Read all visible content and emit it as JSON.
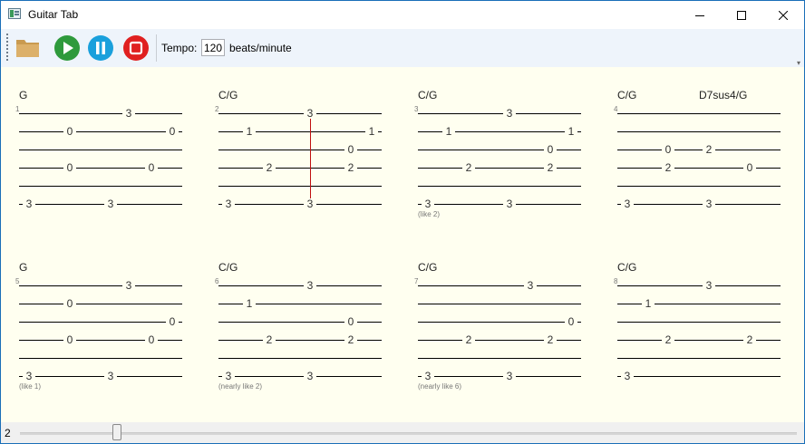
{
  "window": {
    "title": "Guitar Tab"
  },
  "toolbar": {
    "tempo_label": "Tempo:",
    "tempo_value": "120",
    "tempo_unit": "beats/minute",
    "buttons": [
      "open-folder",
      "play",
      "pause",
      "stop"
    ]
  },
  "measures": [
    {
      "number": "1",
      "chords": [
        "G"
      ],
      "note": "",
      "notes": [
        {
          "s": 1,
          "p": 0.67,
          "f": "3"
        },
        {
          "s": 2,
          "p": 0.31,
          "f": "0"
        },
        {
          "s": 2,
          "p": 0.94,
          "f": "0"
        },
        {
          "s": 4,
          "p": 0.31,
          "f": "0"
        },
        {
          "s": 4,
          "p": 0.81,
          "f": "0"
        },
        {
          "s": 6,
          "p": 0.06,
          "f": "3"
        },
        {
          "s": 6,
          "p": 0.56,
          "f": "3"
        }
      ]
    },
    {
      "number": "2",
      "chords": [
        "C/G"
      ],
      "note": "",
      "cursor": 0.56,
      "notes": [
        {
          "s": 1,
          "p": 0.56,
          "f": "3"
        },
        {
          "s": 2,
          "p": 0.19,
          "f": "1"
        },
        {
          "s": 2,
          "p": 0.94,
          "f": "1"
        },
        {
          "s": 3,
          "p": 0.81,
          "f": "0"
        },
        {
          "s": 4,
          "p": 0.31,
          "f": "2"
        },
        {
          "s": 4,
          "p": 0.81,
          "f": "2"
        },
        {
          "s": 6,
          "p": 0.06,
          "f": "3"
        },
        {
          "s": 6,
          "p": 0.56,
          "f": "3"
        }
      ]
    },
    {
      "number": "3",
      "chords": [
        "C/G"
      ],
      "note": "(like 2)",
      "notes": [
        {
          "s": 1,
          "p": 0.56,
          "f": "3"
        },
        {
          "s": 2,
          "p": 0.19,
          "f": "1"
        },
        {
          "s": 2,
          "p": 0.94,
          "f": "1"
        },
        {
          "s": 3,
          "p": 0.81,
          "f": "0"
        },
        {
          "s": 4,
          "p": 0.31,
          "f": "2"
        },
        {
          "s": 4,
          "p": 0.81,
          "f": "2"
        },
        {
          "s": 6,
          "p": 0.06,
          "f": "3"
        },
        {
          "s": 6,
          "p": 0.56,
          "f": "3"
        }
      ]
    },
    {
      "number": "4",
      "chords": [
        "C/G",
        "D7sus4/G"
      ],
      "note": "",
      "notes": [
        {
          "s": 3,
          "p": 0.31,
          "f": "0"
        },
        {
          "s": 3,
          "p": 0.56,
          "f": "2"
        },
        {
          "s": 4,
          "p": 0.31,
          "f": "2"
        },
        {
          "s": 4,
          "p": 0.81,
          "f": "0"
        },
        {
          "s": 6,
          "p": 0.06,
          "f": "3"
        },
        {
          "s": 6,
          "p": 0.56,
          "f": "3"
        }
      ]
    },
    {
      "number": "5",
      "chords": [
        "G"
      ],
      "note": "(like 1)",
      "notes": [
        {
          "s": 1,
          "p": 0.67,
          "f": "3"
        },
        {
          "s": 2,
          "p": 0.31,
          "f": "0"
        },
        {
          "s": 3,
          "p": 0.94,
          "f": "0"
        },
        {
          "s": 4,
          "p": 0.31,
          "f": "0"
        },
        {
          "s": 4,
          "p": 0.81,
          "f": "0"
        },
        {
          "s": 6,
          "p": 0.06,
          "f": "3"
        },
        {
          "s": 6,
          "p": 0.56,
          "f": "3"
        }
      ]
    },
    {
      "number": "6",
      "chords": [
        "C/G"
      ],
      "note": "(nearly like 2)",
      "notes": [
        {
          "s": 1,
          "p": 0.56,
          "f": "3"
        },
        {
          "s": 2,
          "p": 0.19,
          "f": "1"
        },
        {
          "s": 3,
          "p": 0.81,
          "f": "0"
        },
        {
          "s": 4,
          "p": 0.31,
          "f": "2"
        },
        {
          "s": 4,
          "p": 0.81,
          "f": "2"
        },
        {
          "s": 6,
          "p": 0.06,
          "f": "3"
        },
        {
          "s": 6,
          "p": 0.56,
          "f": "3"
        }
      ]
    },
    {
      "number": "7",
      "chords": [
        "C/G"
      ],
      "note": "(nearly like 6)",
      "notes": [
        {
          "s": 1,
          "p": 0.69,
          "f": "3"
        },
        {
          "s": 3,
          "p": 0.94,
          "f": "0"
        },
        {
          "s": 4,
          "p": 0.31,
          "f": "2"
        },
        {
          "s": 4,
          "p": 0.81,
          "f": "2"
        },
        {
          "s": 6,
          "p": 0.06,
          "f": "3"
        },
        {
          "s": 6,
          "p": 0.56,
          "f": "3"
        }
      ]
    },
    {
      "number": "8",
      "chords": [
        "C/G"
      ],
      "note": "",
      "notes": [
        {
          "s": 1,
          "p": 0.56,
          "f": "3"
        },
        {
          "s": 2,
          "p": 0.19,
          "f": "1"
        },
        {
          "s": 4,
          "p": 0.31,
          "f": "2"
        },
        {
          "s": 4,
          "p": 0.81,
          "f": "2"
        },
        {
          "s": 6,
          "p": 0.06,
          "f": "3"
        }
      ]
    }
  ],
  "status": {
    "position": "2",
    "slider_value": 0.12
  },
  "colors": {
    "cursor": "#c01010",
    "play": "#2e9a3c",
    "pause": "#1aa0dc",
    "stop": "#e02020",
    "folder": "#dcb06a"
  }
}
